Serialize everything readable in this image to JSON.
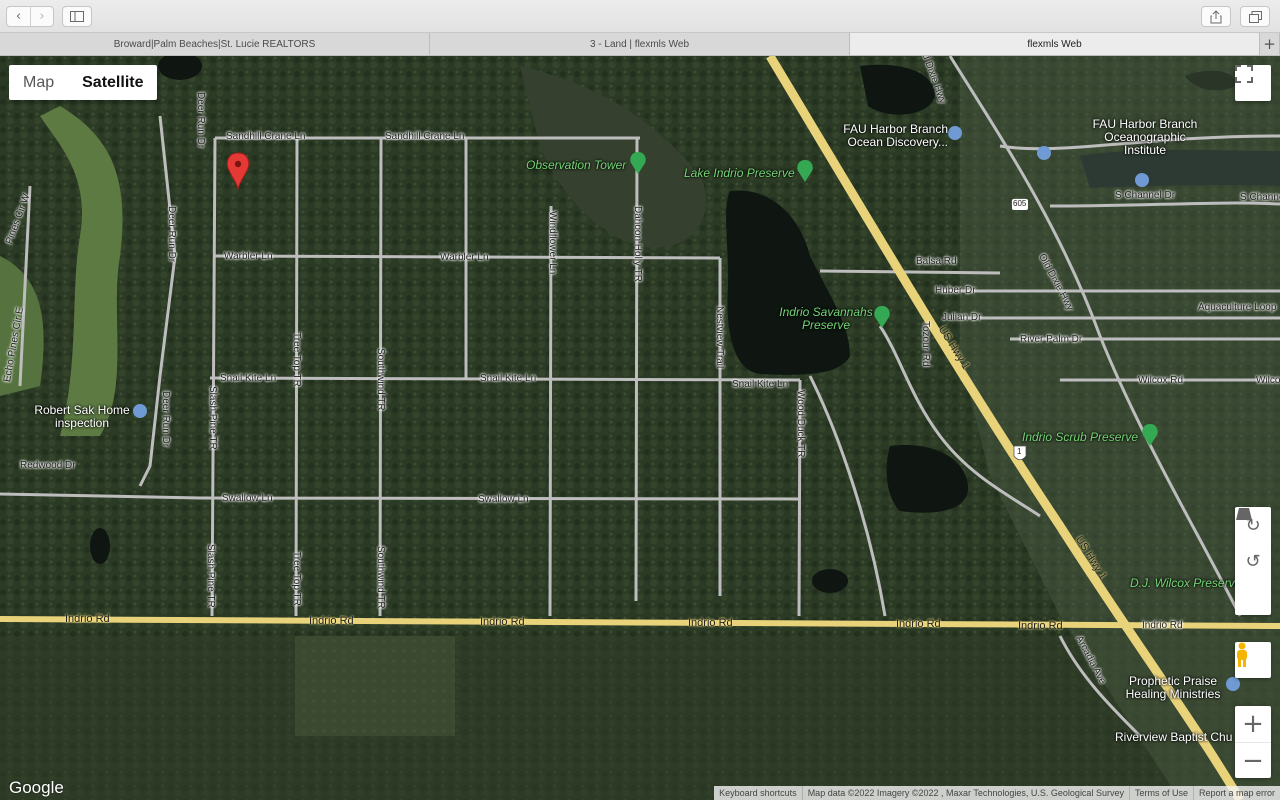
{
  "browser": {
    "back_icon": "chevron-left-icon",
    "forward_icon": "chevron-right-icon",
    "sidebar_icon": "sidebar-icon",
    "share_icon": "share-icon",
    "tabs_icon": "tabs-overview-icon",
    "new_tab_label": "+",
    "tabs": [
      {
        "label": "Broward|Palm Beaches|St. Lucie REALTORS",
        "active": false
      },
      {
        "label": "3 - Land | flexmls Web",
        "active": false
      },
      {
        "label": "flexmls Web",
        "active": true
      }
    ]
  },
  "map": {
    "map_type": {
      "map_label": "Map",
      "satellite_label": "Satellite",
      "selected": "Satellite"
    },
    "fullscreen_icon": "fullscreen-icon",
    "rotate_clockwise_icon": "rotate-clockwise-icon",
    "rotate_counterclockwise_icon": "rotate-counterclockwise-icon",
    "tilt_icon": "tilt-icon",
    "pegman_icon": "pegman-icon",
    "zoom_in_label": "+",
    "zoom_out_label": "−",
    "logo_text": "Google",
    "attribution": {
      "shortcuts": "Keyboard shortcuts",
      "data": "Map data ©2022 Imagery ©2022 , Maxar Technologies, U.S. Geological Survey",
      "terms": "Terms of Use",
      "report": "Report a map error"
    },
    "streets": {
      "sandhill1": "Sandhill Crane Ln",
      "sandhill2": "Sandhill Crane Ln",
      "warbler1": "Warbler Ln",
      "warbler2": "Warbler Ln",
      "snail1": "Snail Kite Ln",
      "snail2": "Snail Kite Ln",
      "snail3": "Snail Kite Ln",
      "swallow1": "Swallow Ln",
      "swallow2": "Swallow Ln",
      "indrio1": "Indrio Rd",
      "indrio2": "Indrio Rd",
      "indrio3": "Indrio Rd",
      "indrio4": "Indrio Rd",
      "indrio5": "Indrio Rd",
      "indrio6": "Indrio Rd",
      "indrio7": "Indrio Rd",
      "redwood": "Redwood Dr",
      "deerrun1": "Deer Run Dr",
      "deerrun2": "Deer Run Dr",
      "deerrun3": "Deer Run Dr",
      "slash1": "Slash Pine TR",
      "slash2": "Slash Pine TR",
      "treetop1": "Tree Top TR",
      "treetop2": "Tree Top TR",
      "southwind1": "Southwind TR",
      "southwind2": "Southwind TR",
      "windflower": "Windflower Ln",
      "dahoon": "Dahoon Holly TR",
      "nestview": "Nestview Trail",
      "woodduck": "Wood Duck TR",
      "tozour": "Tozour Rd",
      "olddixie": "Old Dixie Hwy",
      "olddixie2": "d Dixie Hwy",
      "balsa": "Balsa Rd",
      "huber": "Huber Dr",
      "julian": "Julian Dr",
      "riverpalm": "River Palm Dr",
      "wilcox1": "Wilcox Rd",
      "wilcox2": "Wilco",
      "aquaculture": "Aquaculture Loop",
      "schannel1": "S Channel Dr",
      "schannel2": "S Channel",
      "arcadia": "Arcadia Ave",
      "usHwy1a": "US Hwy 1",
      "usHwy1b": "US Hwy 1",
      "echopines": "Echo Pines Cir E",
      "pinescir": "Pines Cir W",
      "route605": "605",
      "shield1": "1"
    },
    "places": {
      "observation_tower": "Observation Tower",
      "lake_indrio": "Lake Indrio Preserve",
      "indrio_savannahs": "Indrio Savannahs Preserve",
      "indrio_scrub": "Indrio Scrub Preserve",
      "dj_wilcox": "D.J. Wilcox Preserve",
      "fau_branch": "FAU Harbor Branch Ocean Discovery...",
      "fau_institute": "FAU Harbor Branch Oceanographic Institute",
      "robert_sak": "Robert Sak Home inspection",
      "prophetic_praise": "Prophetic Praise Healing Ministries",
      "riverview_baptist": "Riverview Baptist Chu"
    },
    "colors": {
      "road": "#bdbdbd",
      "highway": "#e8d27a",
      "marker": "#e53935",
      "poi_green": "#34a853"
    }
  }
}
